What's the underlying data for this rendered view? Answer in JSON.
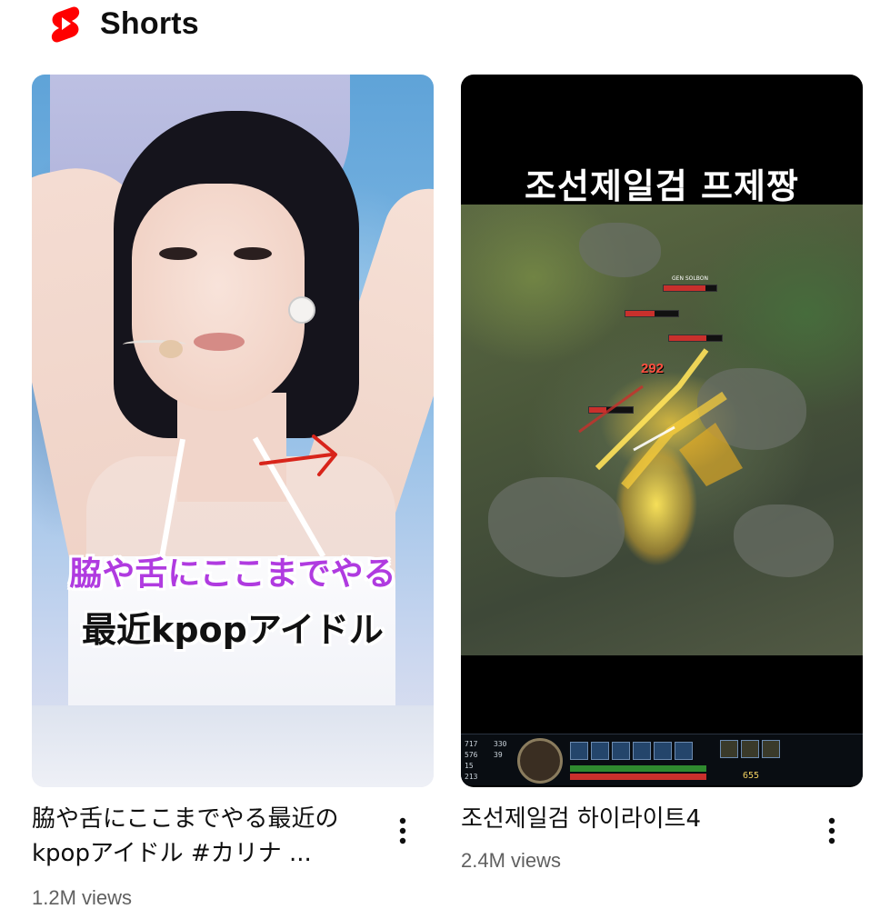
{
  "header": {
    "title": "Shorts",
    "logo_icon": "youtube-shorts-icon",
    "logo_color": "#ff0000"
  },
  "cards": [
    {
      "thumbnail_text": {
        "line1": "脇や舌にここまでやる",
        "line2": "最近kpopアイドル"
      },
      "title": "脇や舌にここまでやる最近のkpopアイドル #カリナ ...",
      "views": "1.2M views"
    },
    {
      "thumbnail_text": {
        "line1": "조선제일검 프제짱"
      },
      "game_labels": {
        "player1": "GEN SOLBON",
        "damage": "292",
        "gold": "655"
      },
      "title": "조선제일검 하이라이트4",
      "views": "2.4M views"
    }
  ],
  "colors": {
    "text_primary": "#0f0f0f",
    "text_secondary": "#606060"
  }
}
